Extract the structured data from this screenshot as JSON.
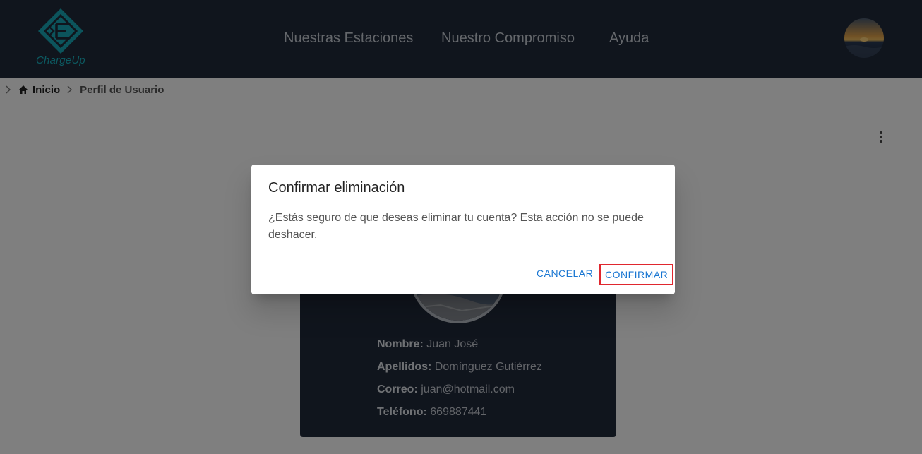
{
  "header": {
    "logo_text": "ChargeUp",
    "nav": [
      "Nuestras Estaciones",
      "Nuestro Compromiso",
      "Ayuda"
    ]
  },
  "breadcrumb": {
    "home": "Inicio",
    "current": "Perfil de Usuario"
  },
  "profile": {
    "fields": [
      {
        "label": "Nombre:",
        "value": "Juan José"
      },
      {
        "label": "Apellidos:",
        "value": "Domínguez Gutiérrez"
      },
      {
        "label": "Correo:",
        "value": "juan@hotmail.com"
      },
      {
        "label": "Teléfono:",
        "value": "669887441"
      }
    ]
  },
  "dialog": {
    "title": "Confirmar eliminación",
    "message": "¿Estás seguro de que deseas eliminar tu cuenta? Esta acción no se puede deshacer.",
    "cancel_label": "CANCELAR",
    "confirm_label": "CONFIRMAR"
  },
  "colors": {
    "header_bg": "#212a3b",
    "brand": "#18b4c3",
    "button_text": "#1976d2",
    "highlight": "#e0272e"
  },
  "icons": [
    "chargeup-logo",
    "chevron-right-icon",
    "home-icon",
    "more-vert-icon",
    "user-avatar"
  ]
}
